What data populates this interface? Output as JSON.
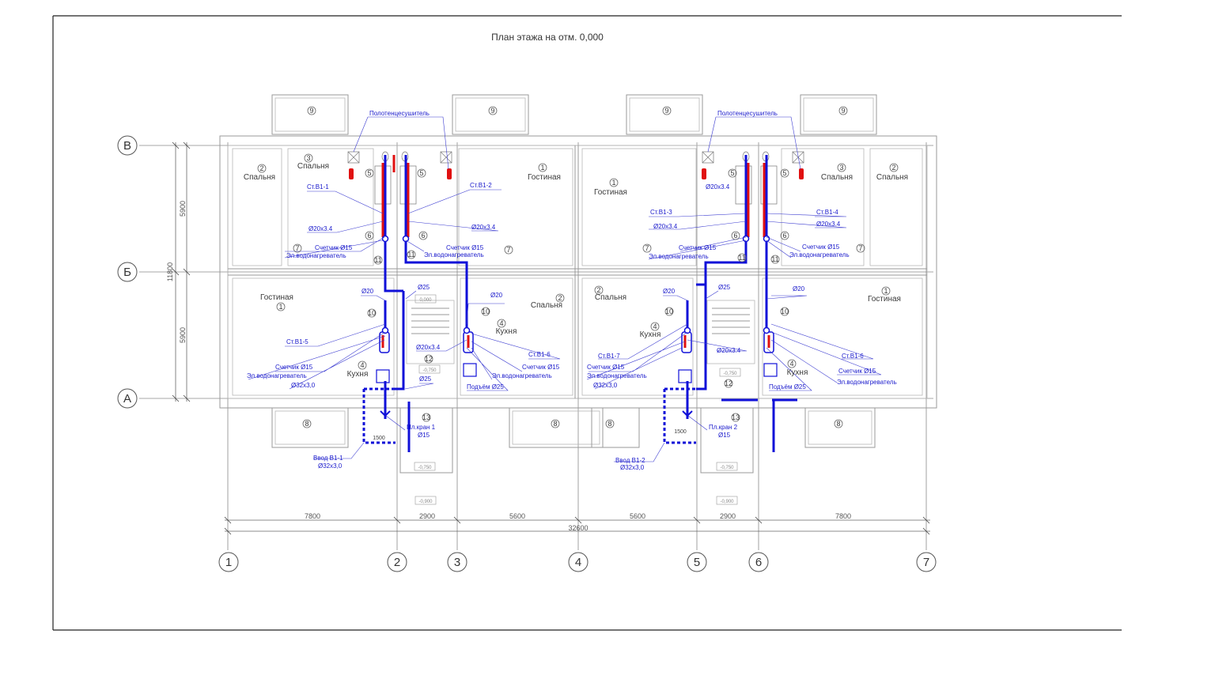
{
  "title": "План этажа на отм. 0,000",
  "axes_letters": [
    "В",
    "Б",
    "А"
  ],
  "axes_numbers": [
    "1",
    "2",
    "3",
    "4",
    "5",
    "6",
    "7"
  ],
  "dims": {
    "bottom": [
      "7800",
      "2900",
      "5600",
      "5600",
      "2900",
      "7800"
    ],
    "total": "32600",
    "left_top": "5900",
    "left_bottom": "5900",
    "left_total": "11800",
    "entry_left": "1500",
    "entry_right": "1500"
  },
  "rooms": {
    "spalnya": "Спальня",
    "gostinaya": "Гостиная",
    "kuhnya": "Кухня"
  },
  "room_numbers": [
    "1",
    "2",
    "3",
    "4",
    "5",
    "6",
    "7",
    "8",
    "9",
    "10",
    "11",
    "12",
    "13"
  ],
  "levels": [
    "0,000",
    "-0,750",
    "-0,750",
    "-0,900",
    "-0,900",
    "-0,750",
    "-0,750"
  ],
  "labels": {
    "towel_left": "Полотенцесушитель",
    "towel_right": "Полотенцесушитель",
    "st1": "Ст.В1-1",
    "st2": "Ст.В1-2",
    "st3": "Ст.В1-3",
    "st4": "Ст.В1-4",
    "st5": "Ст.В1-5",
    "st6a": "Ст.В1-6",
    "st7": "Ст.В1-7",
    "st6b": "Ст.В1-6",
    "d20x34": "Ø20х3.4",
    "d20": "Ø20",
    "d25": "Ø25",
    "d32": "Ø32х3,0",
    "meter": "Счетчик Ø15",
    "heater": "Эл.водонагреватель",
    "rise": "Подъём Ø25",
    "kran1": "Пл.кран 1",
    "kran2": "Пл.кран 2",
    "d15": "Ø15",
    "vvod1": "Ввод В1-1",
    "vvod2": "Ввод В1-2"
  }
}
